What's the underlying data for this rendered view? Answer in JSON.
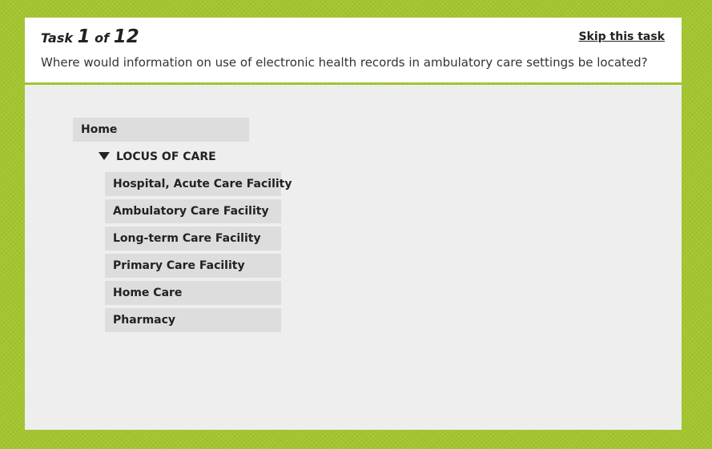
{
  "task": {
    "label": "Task",
    "current": "1",
    "of_label": "of",
    "total": "12",
    "skip_label": "Skip this task",
    "question": "Where would information on use of electronic health records in ambulatory care settings be located?"
  },
  "tree": {
    "home": "Home",
    "category": {
      "label": "LOCUS OF CARE",
      "expanded": true,
      "icon": "triangle-down-icon"
    },
    "children": [
      "Hospital, Acute Care Facility",
      "Ambulatory Care Facility",
      "Long-term Care Facility",
      "Primary Care Facility",
      "Home Care",
      "Pharmacy"
    ]
  },
  "colors": {
    "background": "#a3c52e",
    "panel": "#eeeeee",
    "node": "#dddddd",
    "text": "#222222"
  }
}
